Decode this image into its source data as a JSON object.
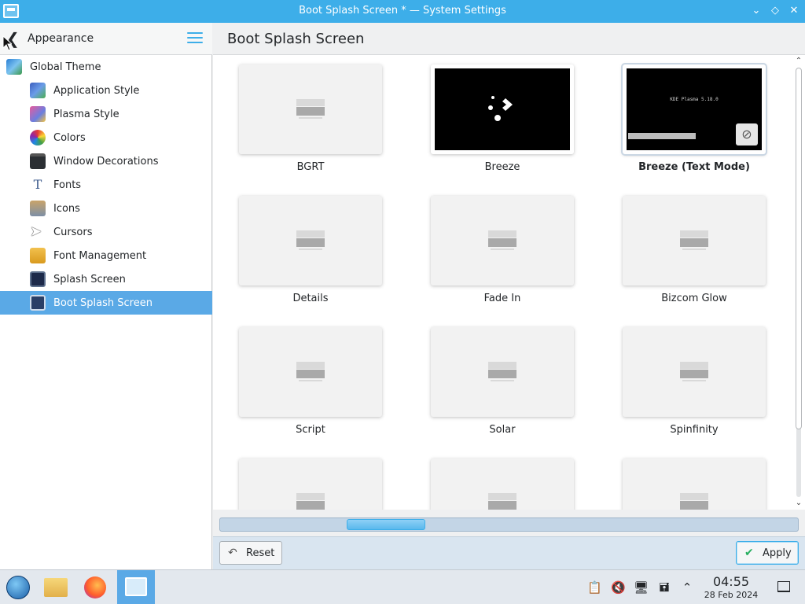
{
  "window": {
    "title": "Boot Splash Screen * — System Settings"
  },
  "sidebar": {
    "header_title": "Appearance",
    "items": [
      {
        "label": "Global Theme"
      },
      {
        "label": "Application Style"
      },
      {
        "label": "Plasma Style"
      },
      {
        "label": "Colors"
      },
      {
        "label": "Window Decorations"
      },
      {
        "label": "Fonts"
      },
      {
        "label": "Icons"
      },
      {
        "label": "Cursors"
      },
      {
        "label": "Font Management"
      },
      {
        "label": "Splash Screen"
      },
      {
        "label": "Boot Splash Screen"
      }
    ]
  },
  "main": {
    "title": "Boot Splash Screen",
    "themes": [
      {
        "name": "BGRT"
      },
      {
        "name": "Breeze"
      },
      {
        "name": "Breeze (Text Mode)",
        "preview_text": "KDE Plasma 5.18.0"
      },
      {
        "name": "Details"
      },
      {
        "name": "Fade In"
      },
      {
        "name": "Bizcom Glow"
      },
      {
        "name": "Script"
      },
      {
        "name": "Solar"
      },
      {
        "name": "Spinfinity"
      }
    ],
    "reset_label": "Reset",
    "apply_label": "Apply"
  },
  "taskbar": {
    "time": "04:55",
    "date": "28 Feb 2024"
  },
  "colors": {
    "accent": "#3daee9",
    "selection": "#5aa9e6"
  }
}
